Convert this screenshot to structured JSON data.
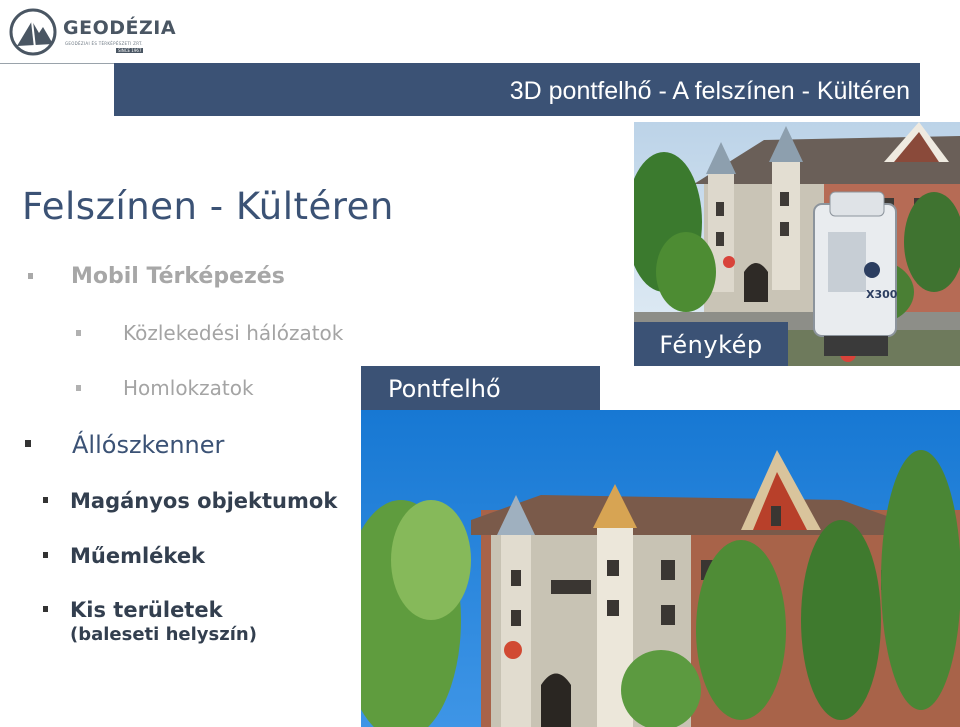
{
  "logo": {
    "name": "GEODÉZIA",
    "tagline": "GEODÉZIAI ÉS TÉRKÉPÉSZETI ZRT.",
    "since": "SINCE 1967"
  },
  "header": {
    "title": "3D pontfelhő -  A felszínen - Kültéren"
  },
  "content": {
    "heading": "Felszínen - Kültéren",
    "bullets": {
      "mobile": "Mobil Térképezés",
      "traffic": "Közlekedési hálózatok",
      "facades": "Homlokzatok",
      "static_scanner": "Állószkenner",
      "single_objects": "Magányos objektumok",
      "monuments": "Műemlékek",
      "small_areas": "Kis területek",
      "small_areas_note": "(baleseti helyszín)"
    }
  },
  "images": {
    "photo_label": "Fénykép",
    "cloud_label": "Pontfelhő",
    "scanner_model": "X300"
  },
  "colors": {
    "brand_blue": "#3b5275",
    "grey_text": "#a7a7a7",
    "dark_text": "#333f4f"
  }
}
